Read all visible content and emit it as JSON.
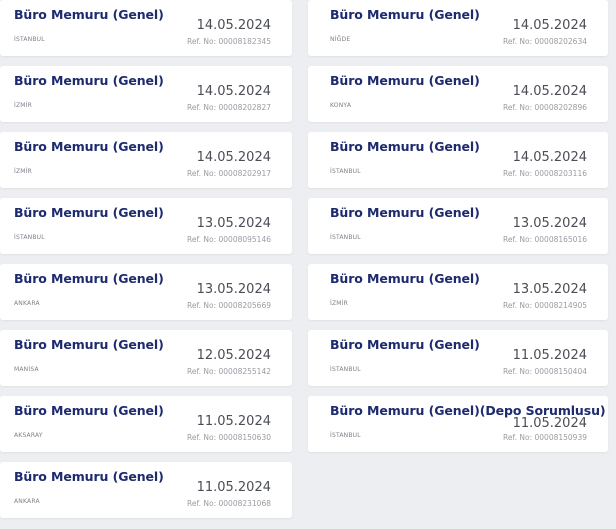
{
  "listings": [
    {
      "title": "Büro Memuru (Genel)",
      "city": "İSTANBUL",
      "date": "14.05.2024",
      "ref": "Ref. No: 00008182345"
    },
    {
      "title": "Büro Memuru (Genel)",
      "city": "NİĞDE",
      "date": "14.05.2024",
      "ref": "Ref. No: 00008202634"
    },
    {
      "title": "Büro Memuru (Genel)",
      "city": "İZMİR",
      "date": "14.05.2024",
      "ref": "Ref. No: 00008202827"
    },
    {
      "title": "Büro Memuru (Genel)",
      "city": "KONYA",
      "date": "14.05.2024",
      "ref": "Ref. No: 00008202896"
    },
    {
      "title": "Büro Memuru (Genel)",
      "city": "İZMİR",
      "date": "14.05.2024",
      "ref": "Ref. No: 00008202917"
    },
    {
      "title": "Büro Memuru (Genel)",
      "city": "İSTANBUL",
      "date": "14.05.2024",
      "ref": "Ref. No: 00008203116"
    },
    {
      "title": "Büro Memuru (Genel)",
      "city": "İSTANBUL",
      "date": "13.05.2024",
      "ref": "Ref. No: 00008095146"
    },
    {
      "title": "Büro Memuru (Genel)",
      "city": "İSTANBUL",
      "date": "13.05.2024",
      "ref": "Ref. No: 00008165016"
    },
    {
      "title": "Büro Memuru (Genel)",
      "city": "ANKARA",
      "date": "13.05.2024",
      "ref": "Ref. No: 00008205669"
    },
    {
      "title": "Büro Memuru (Genel)",
      "city": "İZMİR",
      "date": "13.05.2024",
      "ref": "Ref. No: 00008214905"
    },
    {
      "title": "Büro Memuru (Genel)",
      "city": "MANİSA",
      "date": "12.05.2024",
      "ref": "Ref. No: 00008255142"
    },
    {
      "title": "Büro Memuru (Genel)",
      "city": "İSTANBUL",
      "date": "11.05.2024",
      "ref": "Ref. No: 00008150404"
    },
    {
      "title": "Büro Memuru (Genel)",
      "city": "AKSARAY",
      "date": "11.05.2024",
      "ref": "Ref. No: 00008150630"
    },
    {
      "title": "Büro Memuru (Genel)(Depo Sorumlusu)",
      "city": "İSTANBUL",
      "date": "11.05.2024",
      "ref": "Ref. No: 00008150939"
    },
    {
      "title": "Büro Memuru (Genel)",
      "city": "ANKARA",
      "date": "11.05.2024",
      "ref": "Ref. No: 00008231068"
    }
  ]
}
